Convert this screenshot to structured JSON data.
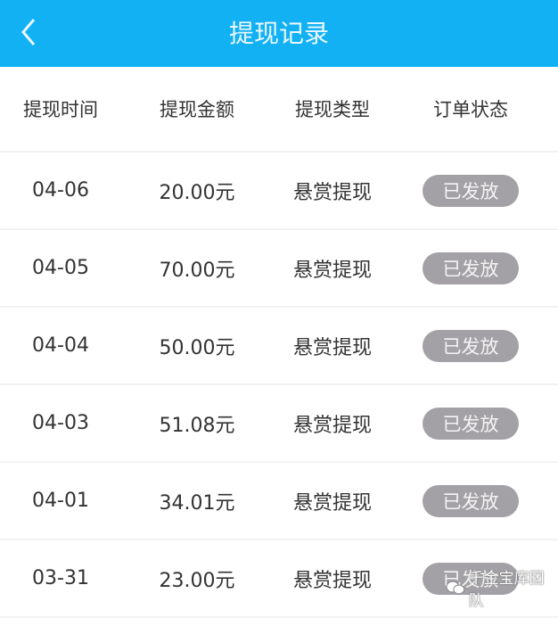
{
  "header": {
    "title": "提现记录",
    "back_icon": "chevron-left-icon",
    "color": "#12b1f4"
  },
  "columns": [
    "提现时间",
    "提现金额",
    "提现类型",
    "订单状态"
  ],
  "rows": [
    {
      "date": "04-06",
      "amount": "20.00元",
      "type": "悬赏提现",
      "status": "已发放"
    },
    {
      "date": "04-05",
      "amount": "70.00元",
      "type": "悬赏提现",
      "status": "已发放"
    },
    {
      "date": "04-04",
      "amount": "50.00元",
      "type": "悬赏提现",
      "status": "已发放"
    },
    {
      "date": "04-03",
      "amount": "51.08元",
      "type": "悬赏提现",
      "status": "已发放"
    },
    {
      "date": "04-01",
      "amount": "34.01元",
      "type": "悬赏提现",
      "status": "已发放"
    },
    {
      "date": "03-31",
      "amount": "23.00元",
      "type": "悬赏提现",
      "status": "已发放"
    }
  ],
  "watermark": {
    "text": "千金宝库团队",
    "icon": "wechat-icon"
  }
}
